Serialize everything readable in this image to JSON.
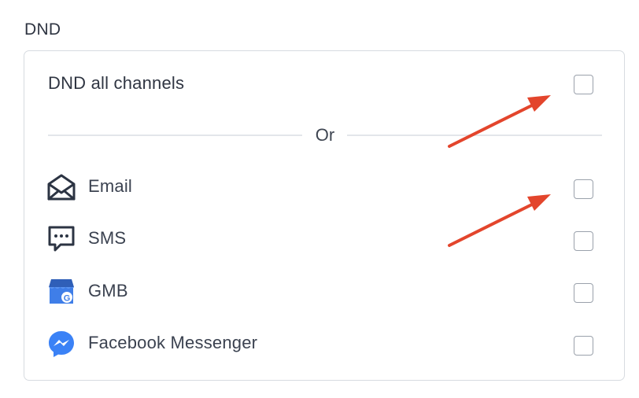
{
  "section": {
    "title": "DND"
  },
  "dnd_all": {
    "label": "DND all channels",
    "checked": false
  },
  "divider": {
    "label": "Or"
  },
  "channels": [
    {
      "label": "Email",
      "icon": "envelope-open-icon",
      "checked": false
    },
    {
      "label": "SMS",
      "icon": "chat-bubble-icon",
      "checked": false
    },
    {
      "label": "GMB",
      "icon": "google-my-business-icon",
      "checked": false
    },
    {
      "label": "Facebook Messenger",
      "icon": "facebook-messenger-icon",
      "checked": false
    }
  ],
  "colors": {
    "arrow": "#e3452c",
    "border": "#d7dbe0",
    "text": "#2f3542",
    "gmb_blue": "#3f7ee8",
    "messenger_blue": "#3b82f6"
  },
  "annotations": [
    {
      "type": "arrow",
      "points_to": "dnd-all-checkbox"
    },
    {
      "type": "arrow",
      "points_to": "email-checkbox"
    }
  ]
}
